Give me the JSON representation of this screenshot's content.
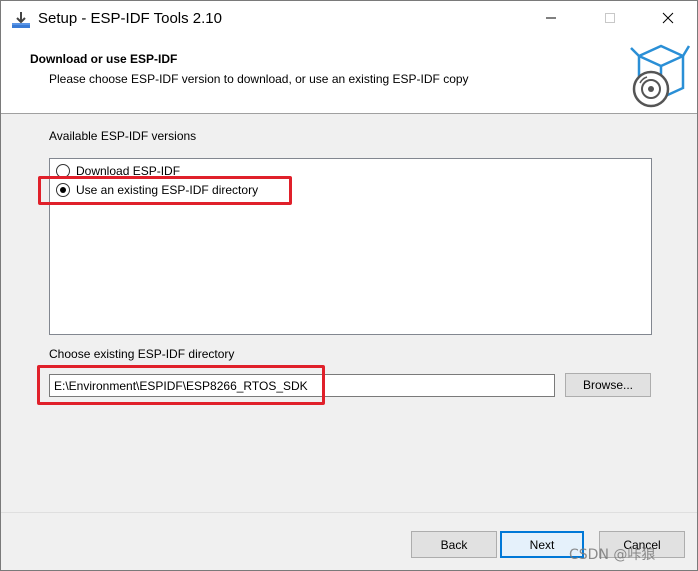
{
  "window": {
    "title": "Setup - ESP-IDF Tools 2.10",
    "controls": {
      "minimize_icon": "minimize-icon",
      "maximize_icon": "maximize-icon",
      "close_icon": "close-icon"
    }
  },
  "header": {
    "title": "Download or use ESP-IDF",
    "subtitle": "Please choose ESP-IDF version to download, or use an existing ESP-IDF copy",
    "icon": "package-disc-icon"
  },
  "versions": {
    "label": "Available ESP-IDF versions",
    "options": [
      {
        "label": "Download ESP-IDF",
        "selected": false
      },
      {
        "label": "Use an existing ESP-IDF directory",
        "selected": true
      }
    ]
  },
  "directory": {
    "label": "Choose existing ESP-IDF directory",
    "value": "E:\\Environment\\ESPIDF\\ESP8266_RTOS_SDK",
    "browse_label": "Browse..."
  },
  "footer": {
    "back_label": "Back",
    "next_label": "Next",
    "cancel_label": "Cancel"
  },
  "watermark": "CSDN @咔狼",
  "colors": {
    "highlight": "#e0202a",
    "accent": "#0078d7",
    "icon_blue": "#2a8fd6"
  }
}
